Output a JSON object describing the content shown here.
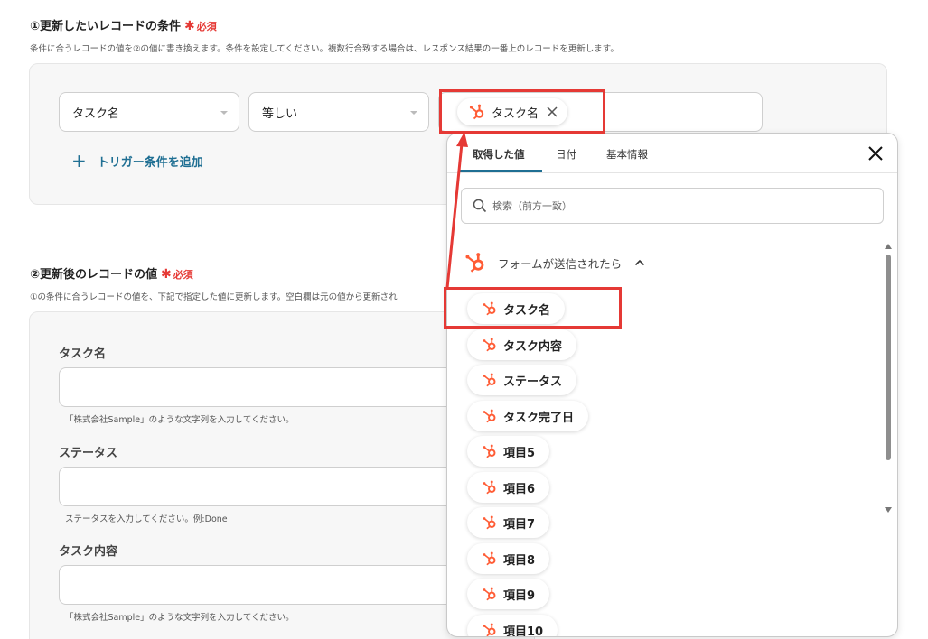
{
  "section1": {
    "num_title": "①更新したいレコードの条件",
    "required_mark": "✱",
    "required_text": "必須",
    "description": "条件に合うレコードの値を②の値に書き換えます。条件を設定してください。複数行合致する場合は、レスポンス結果の一番上のレコードを更新します。",
    "field_select": "タスク名",
    "operator_select": "等しい",
    "value_chip": "タスク名",
    "add_condition": "トリガー条件を追加"
  },
  "section2": {
    "num_title": "②更新後のレコードの値",
    "required_mark": "✱",
    "required_text": "必須",
    "description": "①の条件に合うレコードの値を、下記で指定した値に更新します。空白欄は元の値から更新され",
    "fields": [
      {
        "label": "タスク名",
        "hint": "「株式会社Sample」のような文字列を入力してください。"
      },
      {
        "label": "ステータス",
        "hint": "ステータスを入力してください。例:Done"
      },
      {
        "label": "タスク内容",
        "hint": "「株式会社Sample」のような文字列を入力してください。"
      }
    ]
  },
  "dropdown": {
    "tabs": [
      "取得した値",
      "日付",
      "基本情報"
    ],
    "active_tab": "取得した値",
    "search_placeholder": "検索（前方一致）",
    "group_title": "フォームが送信されたら",
    "items": [
      "タスク名",
      "タスク内容",
      "ステータス",
      "タスク完了日",
      "項目5",
      "項目6",
      "項目7",
      "項目8",
      "項目9",
      "項目10"
    ]
  },
  "colors": {
    "accent": "#1f6f93",
    "hubspot": "#ff5c35",
    "highlight": "#e53935"
  }
}
